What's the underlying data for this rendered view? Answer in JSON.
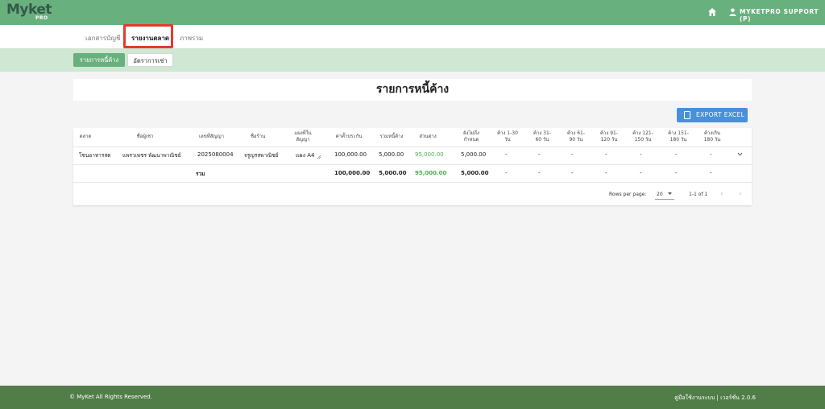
{
  "app": {
    "logo_main": "Myket",
    "logo_sub": "PRO"
  },
  "header": {
    "user_name": "MYKETPRO SUPPORT (P)"
  },
  "tabs": [
    {
      "label": "เอกสารบัญชี"
    },
    {
      "label": "รายงานตลาด",
      "active": true
    },
    {
      "label": "ภาพรวม"
    }
  ],
  "subtabs": [
    {
      "label": "รายการหนี้ค้าง",
      "active": true
    },
    {
      "label": "อัตราการเช่า"
    }
  ],
  "page": {
    "title": "รายการหนี้ค้าง"
  },
  "toolbar": {
    "export_label": "EXPORT EXCEL"
  },
  "table": {
    "columns": [
      {
        "label": "ตลาด"
      },
      {
        "label": "ชื่อผู้เช่า"
      },
      {
        "label": "เลขที่สัญญา"
      },
      {
        "label": "ชื่อร้าน"
      },
      {
        "label": "แผงที่ใน\nสัญญา"
      },
      {
        "label": "ค่าค้ำประกัน"
      },
      {
        "label": "รวมหนี้ค้าง"
      },
      {
        "label": "ส่วนต่าง"
      },
      {
        "label": "ยังไม่ถึง\nกำหนด"
      },
      {
        "label": "ค้าง 1-30\nวัน"
      },
      {
        "label": "ค้าง 31-\n60 วัน"
      },
      {
        "label": "ค้าง 61-\n90 วัน"
      },
      {
        "label": "ค้าง 91-\n120 วัน"
      },
      {
        "label": "ค้าง 121-\n150 วัน"
      },
      {
        "label": "ค้าง 151-\n180 วัน"
      },
      {
        "label": "ค้างเกิน\n180 วัน"
      }
    ],
    "rows": [
      {
        "market": "โซนอาหารสด",
        "tenant": "แพรวเพชร พัฒนาพาณิชย์",
        "contract": "2025080004",
        "shop": "จรูญรสพาณิชย์",
        "stall": "แผง A4",
        "deposit": "100,000.00",
        "total_debt": "5,000.00",
        "difference": "95,000.00",
        "not_due": "5,000.00",
        "d1_30": "-",
        "d31_60": "-",
        "d61_90": "-",
        "d91_120": "-",
        "d121_150": "-",
        "d151_180": "-",
        "d180_plus": "-"
      }
    ],
    "total": {
      "label": "รวม",
      "deposit": "100,000.00",
      "total_debt": "5,000.00",
      "difference": "95,000.00",
      "not_due": "5,000.00",
      "d1_30": "-",
      "d31_60": "-",
      "d61_90": "-",
      "d91_120": "-",
      "d121_150": "-",
      "d151_180": "-",
      "d180_plus": "-"
    }
  },
  "pagination": {
    "rows_per_page_label": "Rows per page:",
    "rows_per_page_value": "20",
    "range": "1-1 of 1"
  },
  "footer": {
    "copyright": "© MyKet All Rights Reserved.",
    "right_text": "คู่มือใช้งานระบบ | เวอร์ชั่น 2.0.6"
  },
  "colors": {
    "brand": "#68b07d",
    "footer": "#517d48",
    "accent": "#4a90d9",
    "positive": "#4caf50",
    "highlight": "#e53a2f"
  }
}
